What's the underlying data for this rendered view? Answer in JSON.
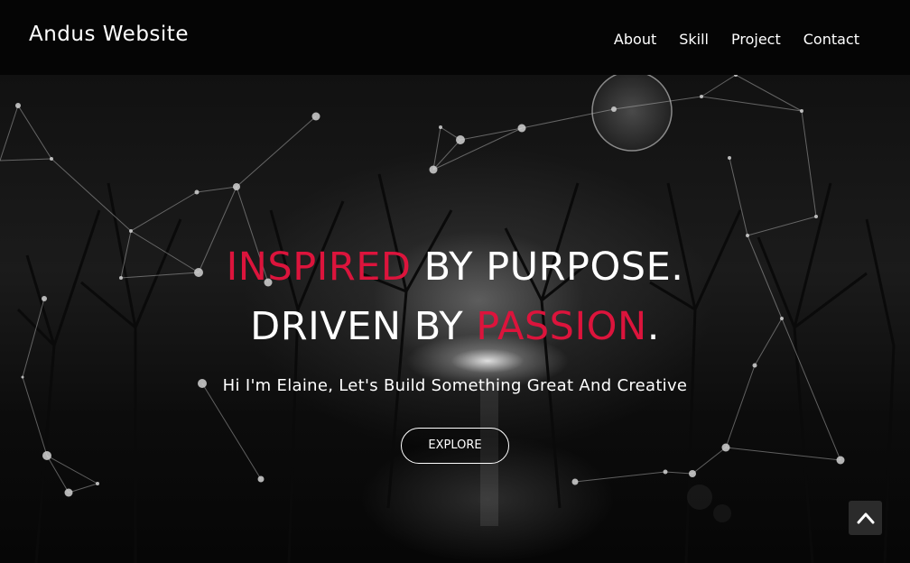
{
  "header": {
    "brand": "Andus Website",
    "nav": [
      "About",
      "Skill",
      "Project",
      "Contact"
    ]
  },
  "hero": {
    "title_line1_accent": "INSPIRED",
    "title_line1_rest": " BY PURPOSE.",
    "title_line2_start": "DRIVEN BY ",
    "title_line2_accent": "PASSION",
    "title_line2_end": ".",
    "tagline": "Hi I'm Elaine, Let's Build Something Great And Creative",
    "explore_label": "EXPLORE"
  },
  "icons": {
    "scroll_top": "chevron-up-icon"
  },
  "colors": {
    "accent": "#dc143c",
    "header_bg": "#050505",
    "text": "#ffffff"
  }
}
